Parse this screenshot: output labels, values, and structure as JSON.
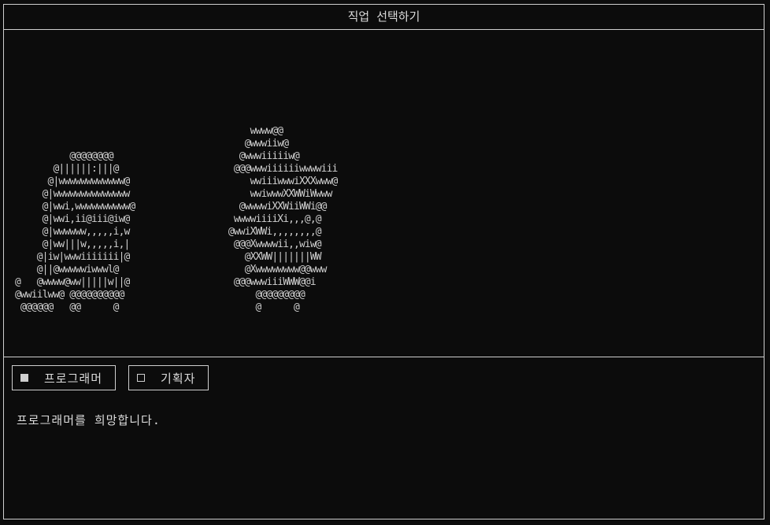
{
  "window": {
    "title": "직업 선택하기"
  },
  "art": {
    "left_lines": [
      "          @@@@@@@@",
      "       @||||||:|||@",
      "      @|wwwwwwwwwwww@",
      "     @|wwwwwwwwwwwwww",
      "     @|wwi,wwwwwwwwww@",
      "     @|wwi,ii@iii@iw@",
      "     @|wwwwww,,,,,i,w",
      "     @|ww|||w,,,,,i,|",
      "    @|iw|wwwiiiiiii|@",
      "    @||@wwwwwiwwwl@",
      "@   @wwww@ww|||||w||@",
      "@wwiilww@ @@@@@@@@@@",
      " @@@@@@   @@      @"
    ],
    "right_lines": [
      "     wwww@@",
      "    @wwwiiw@",
      "   @wwwiiiiiw@",
      "  @@@wwwiiiiiiwwwwiii",
      "     wwiiiwwwiXXXwww@",
      "     wwiwwwXXWWiWwww",
      "   @wwwwiXXWiiWWi@@",
      "  wwwwiiiiXi,,,@,@",
      " @wwiXWWi,,,,,,,,@",
      "  @@@Xwwwwii,,wiw@",
      "    @XXWW|||||||WW",
      "    @Xwwwwwwww@@www",
      "  @@@wwwiiiWWW@@i",
      "      @@@@@@@@@",
      "      @      @"
    ]
  },
  "options": [
    {
      "label": "프로그래머",
      "checked": true
    },
    {
      "label": "기획자",
      "checked": false
    }
  ],
  "status": "프로그래머를 희망합니다."
}
